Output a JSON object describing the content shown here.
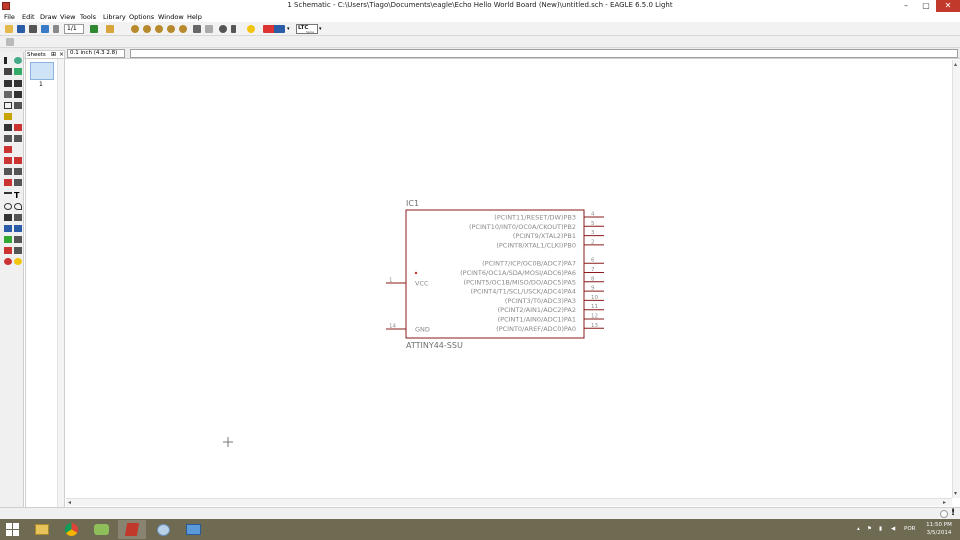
{
  "window": {
    "title": "1 Schematic - C:\\Users\\Tiago\\Documents\\eagle\\Echo Hello World Board (New)\\untitled.sch - EAGLE 6.5.0 Light"
  },
  "menu": [
    "File",
    "Edit",
    "Draw",
    "View",
    "Tools",
    "Library",
    "Options",
    "Window",
    "Help"
  ],
  "toolbar": {
    "sheet_select": "1/1",
    "brand_label": "LTC",
    "brand_sub": "Spice"
  },
  "command": {
    "coordinates": "0.1 inch (4.3 2.8)",
    "input_value": ""
  },
  "sheets_panel": {
    "label": "Sheets",
    "sheets": [
      "1"
    ]
  },
  "schematic": {
    "part_name": "IC1",
    "part_value": "ATTINY44-SSU",
    "left_pins": [
      {
        "num": "1",
        "label": "VCC"
      },
      {
        "num": "14",
        "label": "GND"
      }
    ],
    "right_pins": [
      {
        "num": "4",
        "label": "(PCINT11/RESET/DW)PB3"
      },
      {
        "num": "5",
        "label": "(PCINT10/INT0/OC0A/CKOUT)PB2"
      },
      {
        "num": "3",
        "label": "(PCINT9/XTAL2)PB1"
      },
      {
        "num": "2",
        "label": "(PCINT8/XTAL1/CLKI)PB0"
      },
      {
        "num": "6",
        "label": "(PCINT7/ICP/OC0B/ADC7)PA7"
      },
      {
        "num": "7",
        "label": "(PCINT6/OC1A/SDA/MOSI/ADC6)PA6"
      },
      {
        "num": "8",
        "label": "(PCINT5/OC1B/MISO/DO/ADC5)PA5"
      },
      {
        "num": "9",
        "label": "(PCINT4/T1/SCL/USCK/ADC4)PA4"
      },
      {
        "num": "10",
        "label": "(PCINT3/T0/ADC3)PA3"
      },
      {
        "num": "11",
        "label": "(PCINT2/AIN1/ADC2)PA2"
      },
      {
        "num": "12",
        "label": "(PCINT1/AIN0/ADC1)PA1"
      },
      {
        "num": "13",
        "label": "(PCINT0/AREF/ADC0)PA0"
      }
    ],
    "colors": {
      "body": "#8b1a1a",
      "text": "#8a8a8a"
    }
  },
  "taskbar": {
    "time": "11:50 PM",
    "date": "3/5/2014",
    "language": "POR",
    "apps": [
      "file-explorer-icon",
      "chrome-icon",
      "store-icon",
      "eagle-icon",
      "tool-icon",
      "window-icon"
    ]
  }
}
